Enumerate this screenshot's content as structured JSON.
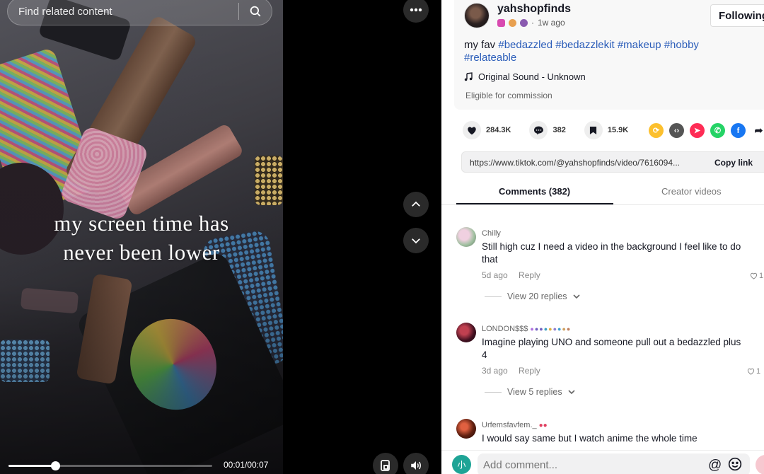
{
  "search": {
    "placeholder": "Find related content",
    "icon": "search-icon"
  },
  "video": {
    "caption_line1": "my screen time has",
    "caption_line2": "never been lower",
    "time": "00:01/00:07",
    "progress": 0.23
  },
  "controls": {
    "more_icon": "more-icon",
    "prev_icon": "chevron-up-icon",
    "next_icon": "chevron-down-icon",
    "miniplayer_icon": "floating-player-icon",
    "volume_icon": "volume-icon"
  },
  "post": {
    "username": "yahshopfinds",
    "time_ago": "1w ago",
    "follow_label": "Following",
    "desc_prefix": "my fav",
    "hashtags": [
      "#bedazzled",
      "#bedazzlekit",
      "#makeup",
      "#hobby",
      "#relateable"
    ],
    "sound": "Original Sound - Unknown",
    "commission": "Eligible for commission"
  },
  "stats": {
    "likes": "284.3K",
    "comments": "382",
    "saves": "15.9K"
  },
  "share": {
    "url": "https://www.tiktok.com/@yahshopfinds/video/7616094...",
    "copy_label": "Copy link"
  },
  "tabs": {
    "comments": "Comments (382)",
    "creator": "Creator videos"
  },
  "comments": [
    {
      "user": "Chilly",
      "text": "Still high cuz I need a video in the background I feel like to do that",
      "age": "5d ago",
      "reply": "Reply",
      "like_count": "1",
      "view_replies": "View 20 replies"
    },
    {
      "user": "LONDON$$$",
      "text": "Imagine playing UNO and someone pull out a bedazzled plus 4",
      "age": "3d ago",
      "reply": "Reply",
      "like_count": "1",
      "view_replies": "View 5 replies"
    },
    {
      "user": "Urfemsfavfem._",
      "text": "I would say same but I watch anime the whole time",
      "age": "",
      "reply": "",
      "like_count": "",
      "view_replies": ""
    }
  ],
  "composer": {
    "placeholder": "Add comment...",
    "me_initial": "小",
    "at_label": "@"
  }
}
